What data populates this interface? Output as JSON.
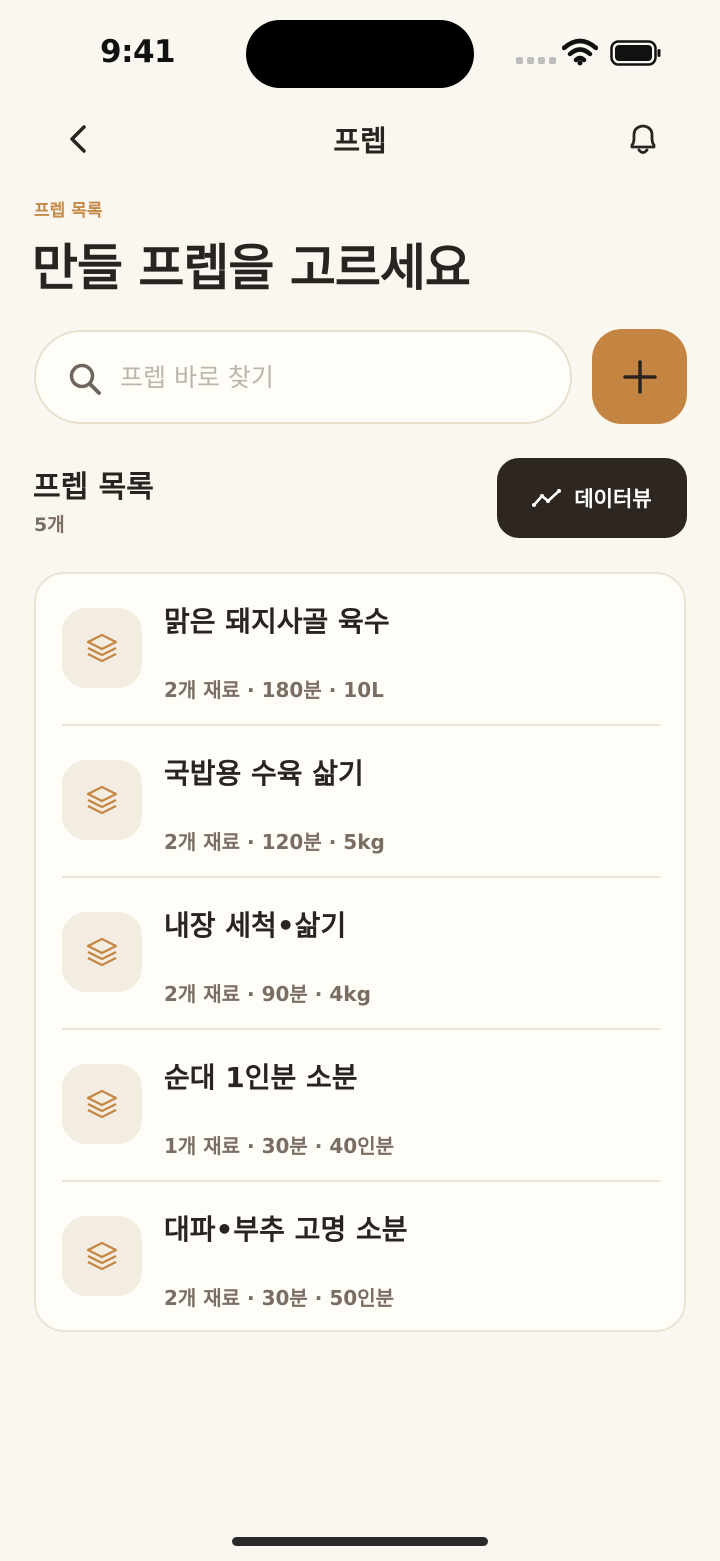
{
  "status_bar": {
    "time": "9:41"
  },
  "nav": {
    "title": "프렙"
  },
  "header": {
    "eyebrow": "프렙 목록",
    "title": "만들 프렙을 고르세요"
  },
  "search": {
    "value": "",
    "placeholder": "프렙 바로 찾기"
  },
  "section": {
    "title": "프렙 목록",
    "count": "5개",
    "dataview_label": "데이터뷰"
  },
  "items": [
    {
      "name": "맑은 돼지사골 육수",
      "meta": "2개 재료 · 180분 · 10L"
    },
    {
      "name": "국밥용 수육 삶기",
      "meta": "2개 재료 · 120분 · 5kg"
    },
    {
      "name": "내장 세척•삶기",
      "meta": "2개 재료 · 90분 · 4kg"
    },
    {
      "name": "순대 1인분 소분",
      "meta": "1개 재료 · 30분 · 40인분"
    },
    {
      "name": "대파•부추 고명 소분",
      "meta": "2개 재료 · 30분 · 50인분"
    }
  ],
  "colors": {
    "background": "#FAF7F0",
    "accent": "#C38541",
    "dark_button": "#2D2621",
    "text_primary": "#2A2420",
    "text_secondary": "#7A6E63"
  },
  "icons": [
    "back-chevron-icon",
    "bell-icon",
    "search-icon",
    "plus-icon",
    "trend-line-icon",
    "layers-icon"
  ]
}
